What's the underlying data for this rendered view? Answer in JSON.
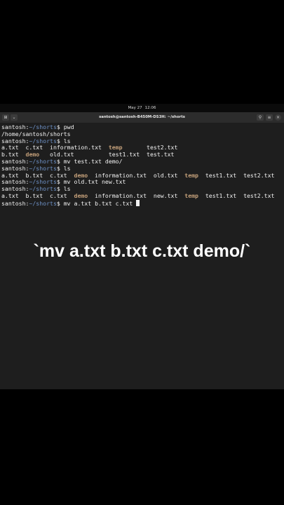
{
  "topbar": {
    "date": "May 27",
    "time": "12:06"
  },
  "window": {
    "title": "santosh@santosh-B450M-DS3H: ~/shorts",
    "new_tab_icon": "terminal-tab-icon",
    "dropdown_icon": "chevron-down-icon",
    "search_icon": "search-icon",
    "menu_icon": "hamburger-menu-icon",
    "close_icon": "close-icon"
  },
  "terminal": {
    "prompt_user": "santosh:",
    "prompt_path": "~/shorts",
    "prompt_symbol": "$ ",
    "line1_cmd": "pwd",
    "line2_out": "/home/santosh/shorts",
    "line3_cmd": "ls",
    "ls1_row1_a": "a.txt  c.txt  information.txt  ",
    "ls1_row1_dir": "temp",
    "ls1_row1_b": "       test2.txt",
    "ls1_row2_a": "b.txt  ",
    "ls1_row2_dir": "demo",
    "ls1_row2_b": "   old.txt          test1.txt  test.txt",
    "line6_cmd": "mv test.txt demo/",
    "line7_cmd": "ls",
    "ls2_a": "a.txt  b.txt  c.txt  ",
    "ls2_dir1": "demo",
    "ls2_b": "  information.txt  old.txt  ",
    "ls2_dir2": "temp",
    "ls2_c": "  test1.txt  test2.txt",
    "line9_cmd": "mv old.txt new.txt",
    "line10_cmd": "ls",
    "ls3_a": "a.txt  b.txt  c.txt  ",
    "ls3_dir1": "demo",
    "ls3_b": "  information.txt  new.txt  ",
    "ls3_dir2": "temp",
    "ls3_c": "  test1.txt  test2.txt",
    "line12_cmd": "mv a.txt b.txt c.txt "
  },
  "caption": "`mv a.txt b.txt c.txt demo/`"
}
